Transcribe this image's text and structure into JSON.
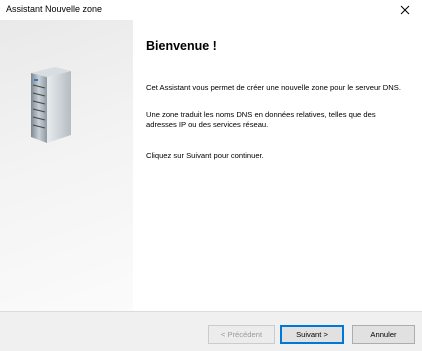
{
  "window": {
    "title": "Assistant Nouvelle zone",
    "close_icon": "close-icon"
  },
  "sidebar": {
    "illustration_icon": "server-icon"
  },
  "main": {
    "heading": "Bienvenue !",
    "paragraph1": "Cet Assistant vous permet de créer une nouvelle zone pour le serveur DNS.",
    "paragraph2": "Une zone traduit les noms DNS en données relatives, telles que des adresses IP ou des services réseau.",
    "paragraph3": "Cliquez sur Suivant pour continuer."
  },
  "footer": {
    "previous_label": "< Précédent",
    "previous_enabled": false,
    "next_label": "Suivant >",
    "cancel_label": "Annuler"
  },
  "colors": {
    "focus_border": "#0078d7",
    "footer_bg": "#f0f0f0",
    "disabled_text": "#9a9a9a"
  }
}
